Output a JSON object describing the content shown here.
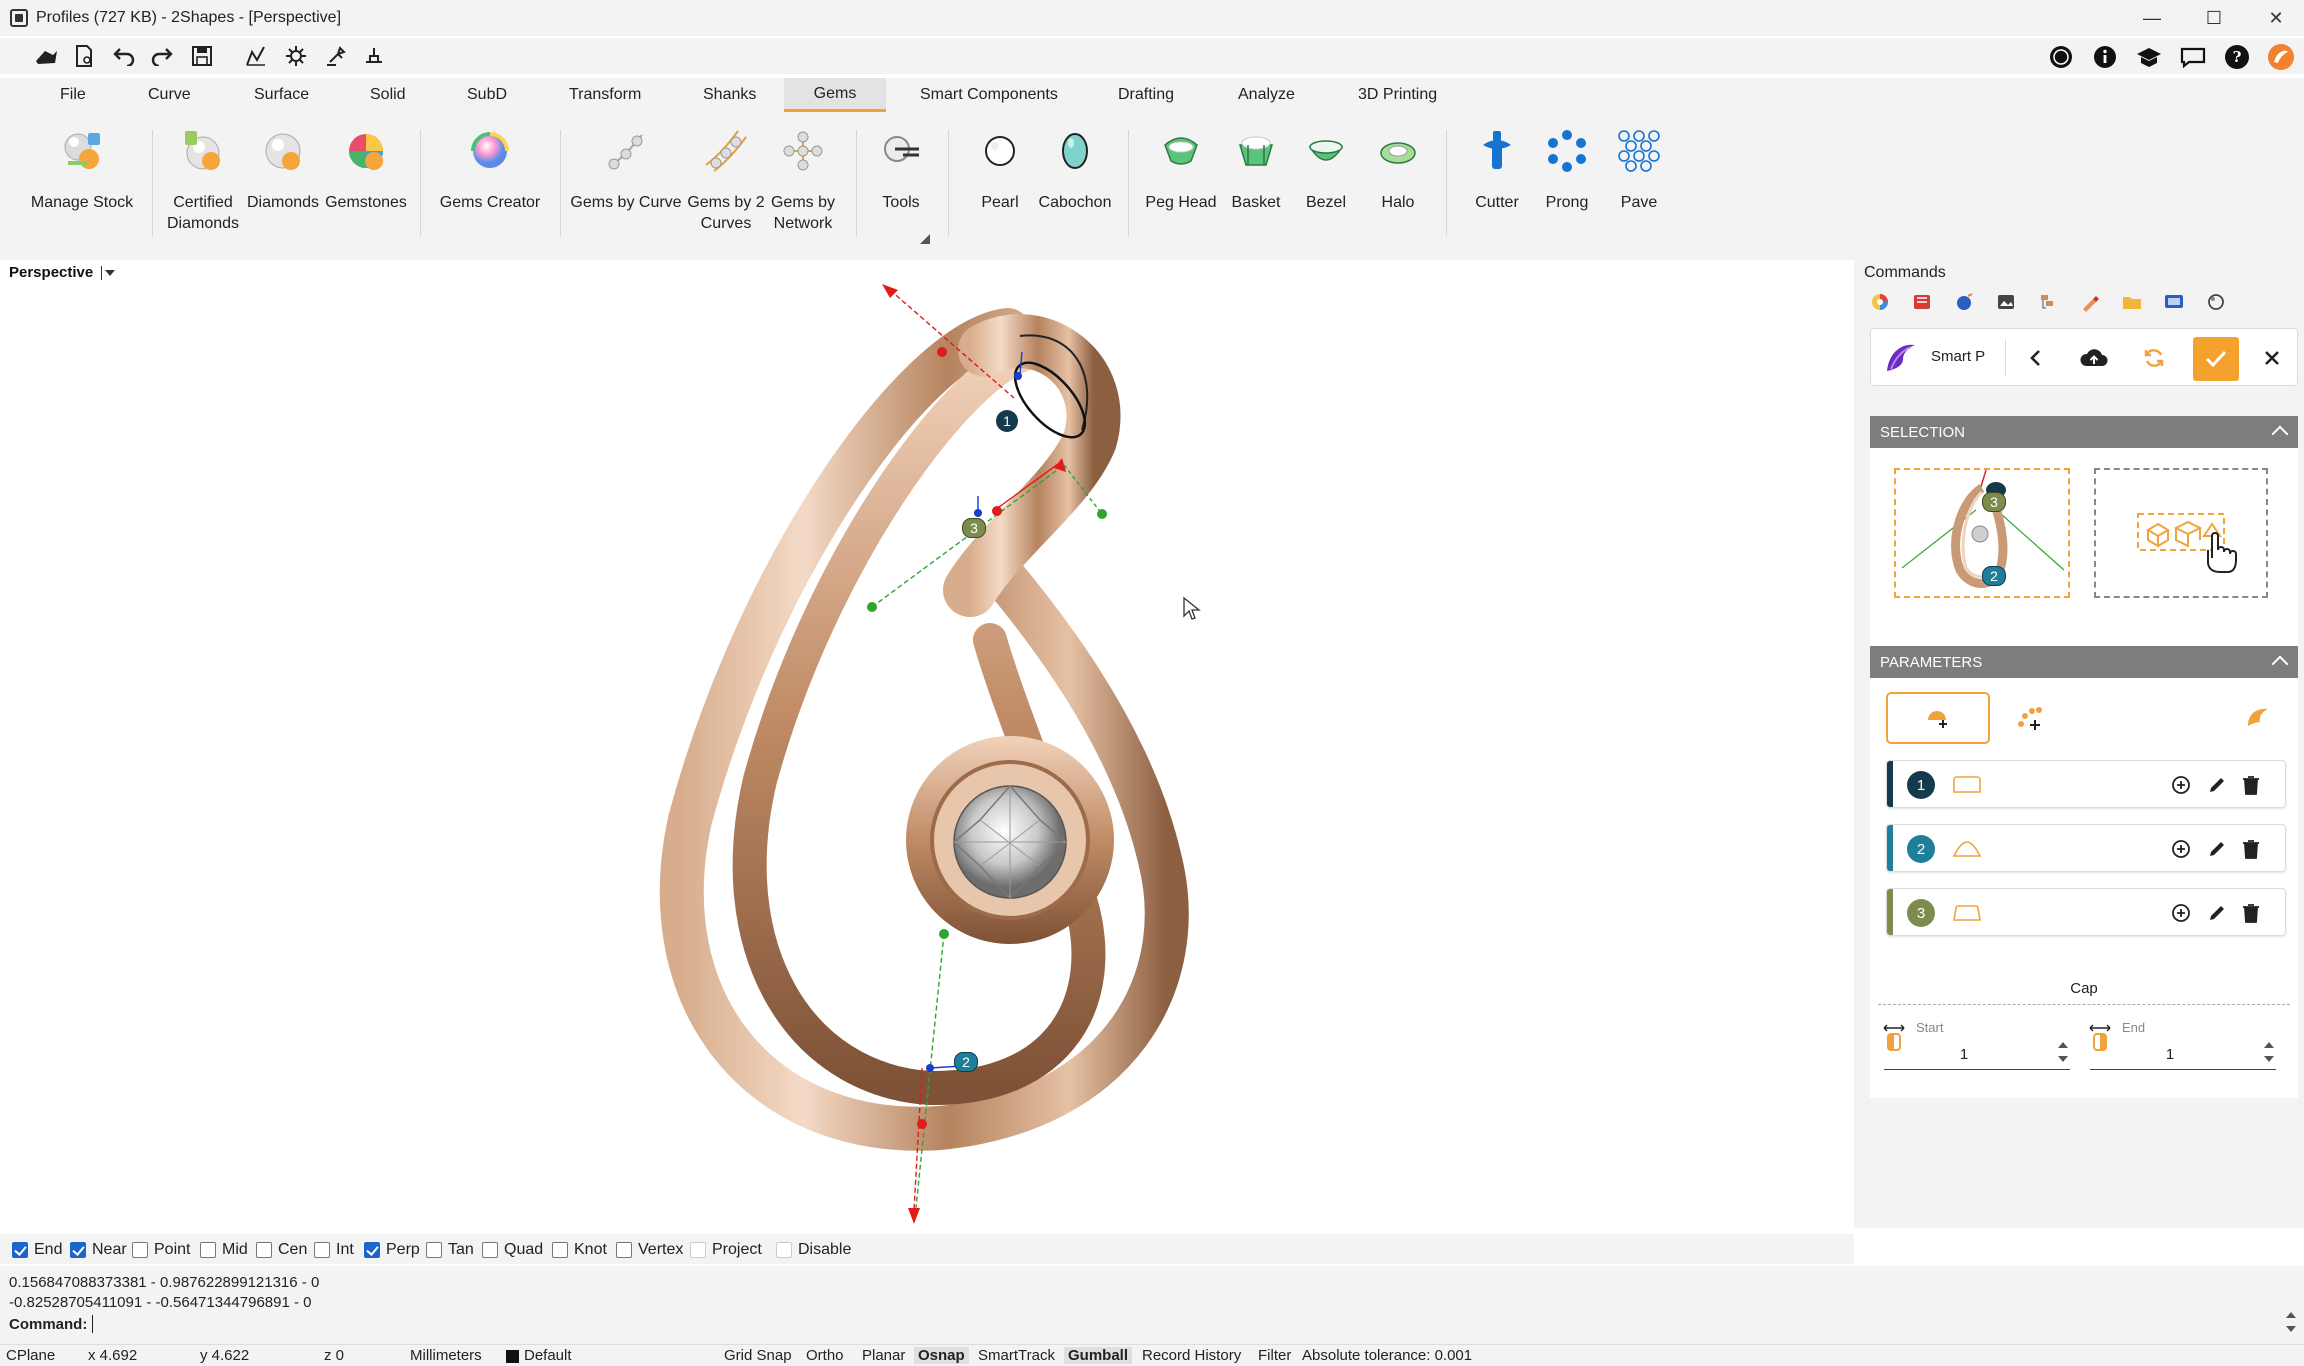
{
  "window": {
    "title": "Profiles (727 KB) - 2Shapes - [Perspective]",
    "minimize": "—",
    "maximize": "☐",
    "close": "✕"
  },
  "help_glyph": "?",
  "menu_tabs": [
    "File",
    "Curve",
    "Surface",
    "Solid",
    "SubD",
    "Transform",
    "Shanks",
    "Gems",
    "Smart Components",
    "Drafting",
    "Analyze",
    "3D Printing"
  ],
  "active_tab": "Gems",
  "ribbon": {
    "manage_stock": "Manage Stock",
    "certified_diamonds": "Certified\nDiamonds",
    "diamonds": "Diamonds",
    "gemstones": "Gemstones",
    "gems_creator": "Gems Creator",
    "gems_by_curve": "Gems by Curve",
    "gems_by_2_curves": "Gems by 2\nCurves",
    "gems_by_network": "Gems by\nNetwork",
    "tools": "Tools",
    "pearl": "Pearl",
    "cabochon": "Cabochon",
    "peg_head": "Peg Head",
    "basket": "Basket",
    "bezel": "Bezel",
    "halo": "Halo",
    "cutter": "Cutter",
    "prong": "Prong",
    "pave": "Pave"
  },
  "viewport": {
    "label": "Perspective",
    "markers": [
      "1",
      "2",
      "3"
    ]
  },
  "panel": {
    "title": "Commands",
    "smart_label": "Smart P",
    "selection_header": "SELECTION",
    "selection_markers": [
      "3",
      "2"
    ],
    "parameters_header": "PARAMETERS",
    "rows": [
      {
        "num": "1",
        "color": "#153a4b"
      },
      {
        "num": "2",
        "color": "#1f7f9a"
      },
      {
        "num": "3",
        "color": "#7d8c4d"
      }
    ],
    "cap_label": "Cap",
    "start_label": "Start",
    "start_value": "1",
    "end_label": "End",
    "end_value": "1"
  },
  "snaps": [
    {
      "label": "End",
      "checked": true
    },
    {
      "label": "Near",
      "checked": true
    },
    {
      "label": "Point",
      "checked": false
    },
    {
      "label": "Mid",
      "checked": false
    },
    {
      "label": "Cen",
      "checked": false
    },
    {
      "label": "Int",
      "checked": false
    },
    {
      "label": "Perp",
      "checked": true
    },
    {
      "label": "Tan",
      "checked": false
    },
    {
      "label": "Quad",
      "checked": false
    },
    {
      "label": "Knot",
      "checked": false
    },
    {
      "label": "Vertex",
      "checked": false
    },
    {
      "label": "Project",
      "checked": false
    },
    {
      "label": "Disable",
      "checked": false
    }
  ],
  "command_history": [
    "0.156847088373381 - 0.987622899121316 - 0",
    "-0.82528705411091 - -0.564713447968​91 - 0"
  ],
  "command_prompt": "Command:",
  "status": {
    "cplane": "CPlane",
    "x": "x 4.692",
    "y": "y 4.622",
    "z": "z 0",
    "units": "Millimeters",
    "layer": "Default",
    "grid_snap": "Grid Snap",
    "ortho": "Ortho",
    "planar": "Planar",
    "osnap": "Osnap",
    "smarttrack": "SmartTrack",
    "gumball": "Gumball",
    "record_history": "Record History",
    "filter": "Filter",
    "tolerance": "Absolute tolerance: 0.001"
  },
  "colors": {
    "accent": "#f2a23a",
    "metal": "#c99a78",
    "selected_blue": "#1a66c9"
  }
}
